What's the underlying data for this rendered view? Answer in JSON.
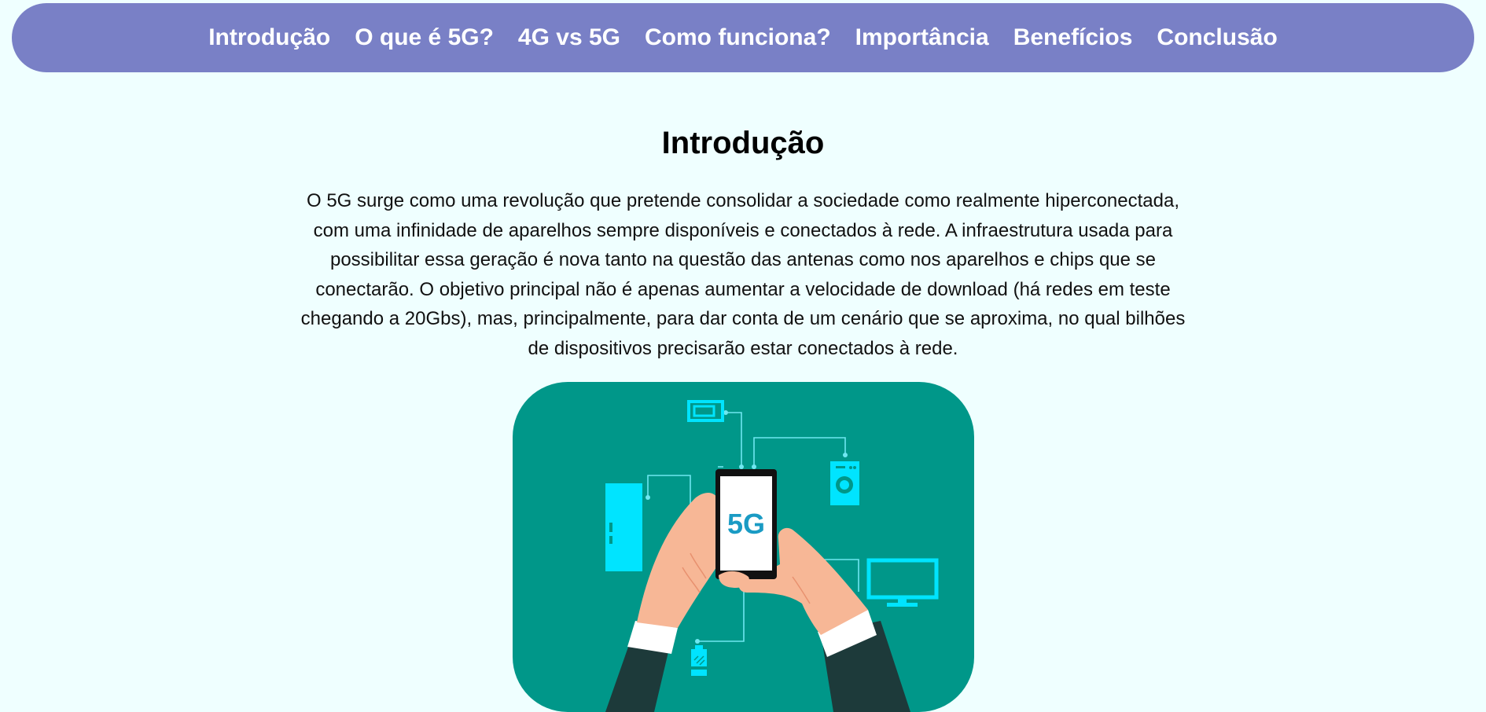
{
  "nav": {
    "items": [
      {
        "label": "Introdução"
      },
      {
        "label": "O que é 5G?"
      },
      {
        "label": "4G vs 5G"
      },
      {
        "label": "Como funciona?"
      },
      {
        "label": "Importância"
      },
      {
        "label": "Benefícios"
      },
      {
        "label": "Conclusão"
      }
    ]
  },
  "intro": {
    "title": "Introdução",
    "text": "O 5G surge como uma revolução que pretende consolidar a sociedade como realmente hiperconectada, com uma infinidade de aparelhos sempre disponíveis e conectados à rede. A infraestrutura usada para possibilitar essa geração é nova tanto na questão das antenas como nos aparelhos e chips que se conectarão. O objetivo principal não é apenas aumentar a velocidade de download (há redes em teste chegando a 20Gbs), mas, principalmente, para dar conta de um cenário que se aproxima, no qual bilhões de dispositivos precisarão estar conectados à rede."
  },
  "illustration": {
    "phone_text": "5G",
    "colors": {
      "background": "#009789",
      "device": "#00e4ff",
      "skin": "#f7b796",
      "sleeve": "#1d3a3a",
      "cuff": "#ffffff",
      "screen_text": "#1a9bc4"
    }
  },
  "colors": {
    "page_background": "#efffff",
    "nav_background": "#7980c6",
    "nav_text": "#ffffff"
  }
}
